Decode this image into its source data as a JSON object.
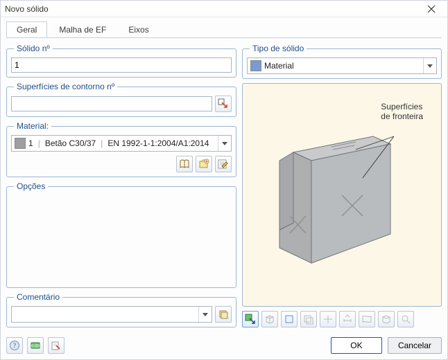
{
  "window": {
    "title": "Novo sólido"
  },
  "tabs": {
    "geral": "Geral",
    "malha": "Malha de EF",
    "eixos": "Eixos"
  },
  "left": {
    "solidoNo": {
      "legend": "Sólido nº",
      "value": "1"
    },
    "superficies": {
      "legend": "Superfícies de contorno nº",
      "value": ""
    },
    "material": {
      "legend": "Material:",
      "num": "1",
      "name": "Betão C30/37",
      "norm": "EN 1992-1-1:2004/A1:2014"
    },
    "opcoes": {
      "legend": "Opções"
    },
    "comentario": {
      "legend": "Comentário",
      "value": ""
    }
  },
  "right": {
    "tipo": {
      "legend": "Tipo de sólido",
      "value": "Material",
      "swatch": "#7a9ad6"
    },
    "preview": {
      "label1": "Superfícies",
      "label2": "de fronteira"
    }
  },
  "footer": {
    "ok": "OK",
    "cancel": "Cancelar"
  },
  "icons": {
    "pick_surfaces": "pick-icon",
    "mat_lib": "book-icon",
    "mat_new": "new-folder-icon",
    "mat_edit": "edit-icon",
    "stack": "stack-icon",
    "help": "help-icon",
    "precision": "precision-icon",
    "favorite": "favorite-icon"
  }
}
